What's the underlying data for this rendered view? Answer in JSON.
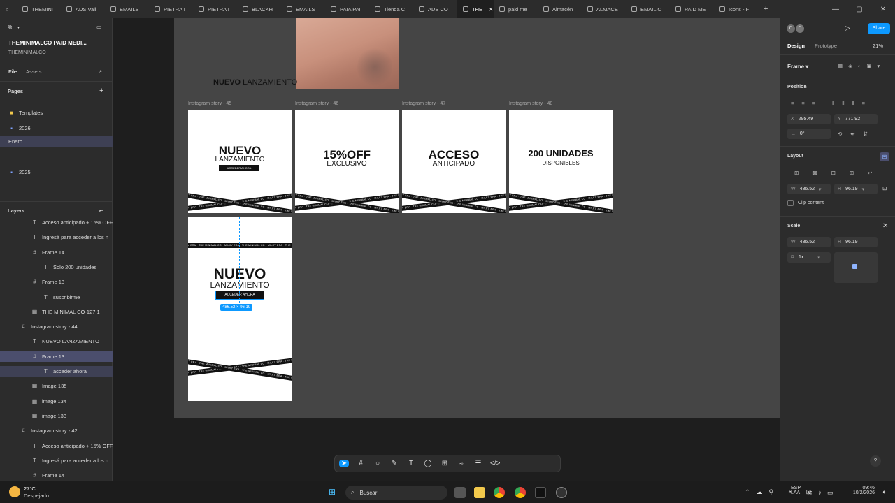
{
  "tabs": [
    "THEMINI",
    "ADS Vali",
    "EMAILS",
    "PIETRA I",
    "PIETRA I",
    "BLACKH",
    "EMAILS",
    "PAIA PAI",
    "Tienda C",
    "ADS CO",
    "THE",
    "paid me",
    "Almacén",
    "ALMACE",
    "EMAIL C",
    "PAID ME",
    "Icons - F"
  ],
  "file": {
    "title": "THEMINIMALCO PAID MEDI...",
    "team": "THEMINIMALCO",
    "tab_file": "File",
    "tab_assets": "Assets"
  },
  "pages": {
    "title": "Pages",
    "items": [
      "Templates",
      "2026",
      "Enero",
      "2025"
    ]
  },
  "layers": {
    "title": "Layers",
    "items": [
      "Acceso anticipado + 15% OFF",
      "Ingresá para acceder a los n",
      "Frame 14",
      "Solo 200 unidades",
      "Frame 13",
      "suscribirme",
      "THE MINIMAL CO-127 1",
      "Instagram story - 44",
      "NUEVO LANZAMIENTO",
      "Frame 13",
      "acceder ahora",
      "Image 135",
      "image 134",
      "image 133",
      "Instagram story - 42",
      "Acceso anticipado + 15% OFF",
      "Ingresá para acceder a los n",
      "Frame 14"
    ]
  },
  "canvas": {
    "top_text_bold": "NUEVO",
    "top_text_rest": " LANZAMIENTO",
    "frames": [
      {
        "label": "Instagram story - 45",
        "big": "NUEVO",
        "sub": "LANZAMIENTO",
        "btn": "ACCEDER AHORA"
      },
      {
        "label": "Instagram story - 46",
        "big": "15%OFF",
        "sub": "EXCLUSIVO"
      },
      {
        "label": "Instagram story - 47",
        "big": "ACCESO",
        "sub": "ANTICIPADO"
      },
      {
        "label": "Instagram story - 48",
        "big": "200 UNIDADES",
        "sub": "DISPONIBLES"
      }
    ],
    "story44": {
      "big": "NUEVO",
      "sub": "LANZAMIENTO",
      "btn": "ACCEDER AHORA",
      "size_badge": "486.52 × 96.19"
    },
    "band_text": "MILKY ERA · THE MINIMAL CO · MILKY ERA · THE MINIMAL CO · MILKY ERA · THE MINIMAL CO · MILKY ERA"
  },
  "right": {
    "share": "Share",
    "design": "Design",
    "prototype": "Prototype",
    "zoom": "21%",
    "frame": "Frame",
    "position": "Position",
    "x_label": "X",
    "x": "295.49",
    "y_label": "Y",
    "y": "771.92",
    "rot": "0°",
    "layout": "Layout",
    "w_label": "W",
    "w": "486.52",
    "h_label": "H",
    "h": "96.19",
    "clip": "Clip content",
    "scale": "Scale",
    "sw": "486.52",
    "sh": "96.19",
    "scale_val": "1x",
    "avatars": [
      "D",
      "D"
    ]
  },
  "taskbar": {
    "temp": "27°C",
    "weather": "Despejado",
    "search": "Buscar",
    "lang1": "ESP",
    "lang2": "LAA",
    "time": "09:46",
    "date": "10/2/2026"
  },
  "colors": {
    "accent": "#0d99ff",
    "selection": "#4b4e6d"
  }
}
